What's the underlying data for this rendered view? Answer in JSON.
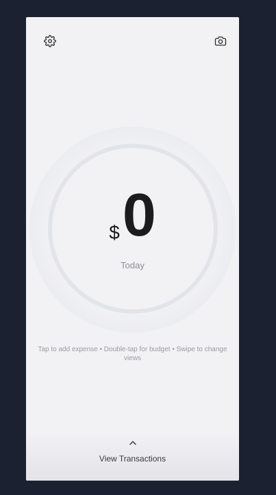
{
  "header": {
    "settings_icon": "gear-icon",
    "camera_icon": "camera-icon"
  },
  "summary": {
    "currency": "$",
    "amount": "0",
    "period": "Today"
  },
  "hint": {
    "text": "Tap to add expense • Double-tap for budget • Swipe to change views"
  },
  "footer": {
    "icon": "chevron-up-icon",
    "label": "View Transactions"
  },
  "colors": {
    "background": "#1b2130",
    "surface": "#f2f2f5",
    "ring": "#e3e4e9",
    "text_primary": "#1c1c1e",
    "text_secondary": "#8e8e93"
  }
}
